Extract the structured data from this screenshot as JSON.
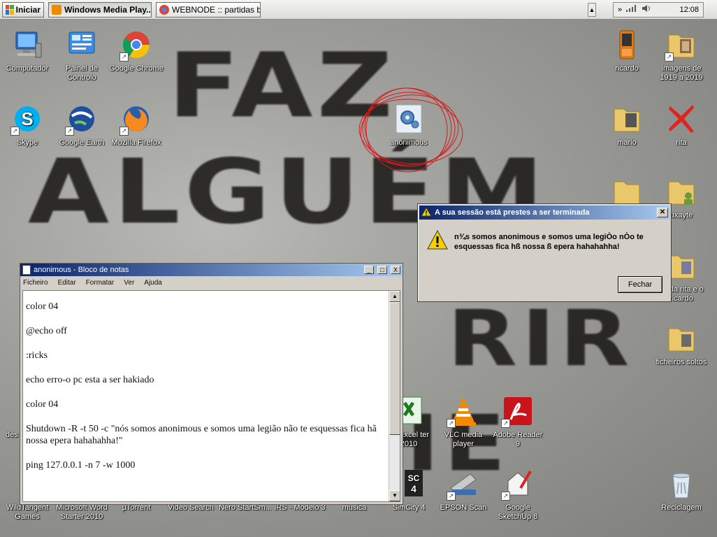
{
  "taskbar": {
    "start_label": "Iniciar",
    "tasks": [
      {
        "label": "Windows Media Play...",
        "active": true
      },
      {
        "label": "WEBNODE :: partidas b...",
        "active": false
      }
    ],
    "tray_chevron": "»",
    "clock": "12:08"
  },
  "wallpaper": {
    "line1": "FAZ",
    "line2": "ALGUÉM",
    "line3": "RIR",
    "line4": "HE"
  },
  "desktop_icons": [
    {
      "label": "Computador",
      "icon": "computer-icon"
    },
    {
      "label": "Painel de Controlo",
      "icon": "control-panel-icon"
    },
    {
      "label": "Google Chrome",
      "icon": "chrome-icon"
    },
    {
      "label": "Skype",
      "icon": "skype-icon"
    },
    {
      "label": "Google Earth",
      "icon": "google-earth-icon"
    },
    {
      "label": "Mozilla Firefox",
      "icon": "firefox-icon"
    },
    {
      "label": "anonimous",
      "icon": "gear-file-icon"
    },
    {
      "label": "ricardo",
      "icon": "phone-icon"
    },
    {
      "label": "imagens de 1919 a 2019",
      "icon": "folder-icon"
    },
    {
      "label": "mario",
      "icon": "folder-icon"
    },
    {
      "label": "rita",
      "icon": "red-x-icon"
    },
    {
      "label": "uxayte",
      "icon": "folder-user-icon"
    },
    {
      "label": "os da rita e o ricardo",
      "icon": "folder-icon"
    },
    {
      "label": "ficheiros soltos",
      "icon": "folder-icon"
    },
    {
      "label": "oft Excel ter 2010",
      "icon": "excel-icon"
    },
    {
      "label": "VLC media player",
      "icon": "vlc-icon"
    },
    {
      "label": "Adobe Reader 9",
      "icon": "adobe-reader-icon"
    },
    {
      "label": "SimCity 4",
      "icon": "simcity-icon"
    },
    {
      "label": "EPSON Scan",
      "icon": "scanner-icon"
    },
    {
      "label": "Google SketchUp 8",
      "icon": "sketchup-icon"
    },
    {
      "label": "Reciclagem",
      "icon": "recycle-bin-icon"
    },
    {
      "label": "WildTangent Games",
      "icon": "wildtangent-icon"
    },
    {
      "label": "Microsoft Word Starter 2010",
      "icon": "word-icon"
    },
    {
      "label": "µTorrent",
      "icon": "utorrent-icon"
    },
    {
      "label": "Video Search",
      "icon": "video-search-icon"
    },
    {
      "label": "Nero StartSm...",
      "icon": "nero-icon"
    },
    {
      "label": "IRS - Modelo 3",
      "icon": "irs-icon"
    },
    {
      "label": "musica",
      "icon": "folder-icon"
    },
    {
      "label": "des",
      "icon": "app-icon"
    }
  ],
  "notepad": {
    "title": "anonimous - Bloco de notas",
    "menu": [
      "Ficheiro",
      "Editar",
      "Formatar",
      "Ver",
      "Ajuda"
    ],
    "lines": [
      "color 04",
      "@echo off",
      ":ricks",
      "echo erro-o pc esta a ser hakiado",
      "color 04",
      "Shutdown -R -t 50 -c \"nós somos anonimous e somos uma legião não te esquessas fica hã nossa epera hahahahha!\"",
      "ping 127.0.0.1 -n 7 -w 1000"
    ]
  },
  "message_box": {
    "title": "A sua sessão está prestes a ser terminada",
    "text": "n¾s somos anonimous e somos uma legiÒo nÒo te esquessas fica hß nossa ß epera hahahahha!",
    "button": "Fechar"
  }
}
